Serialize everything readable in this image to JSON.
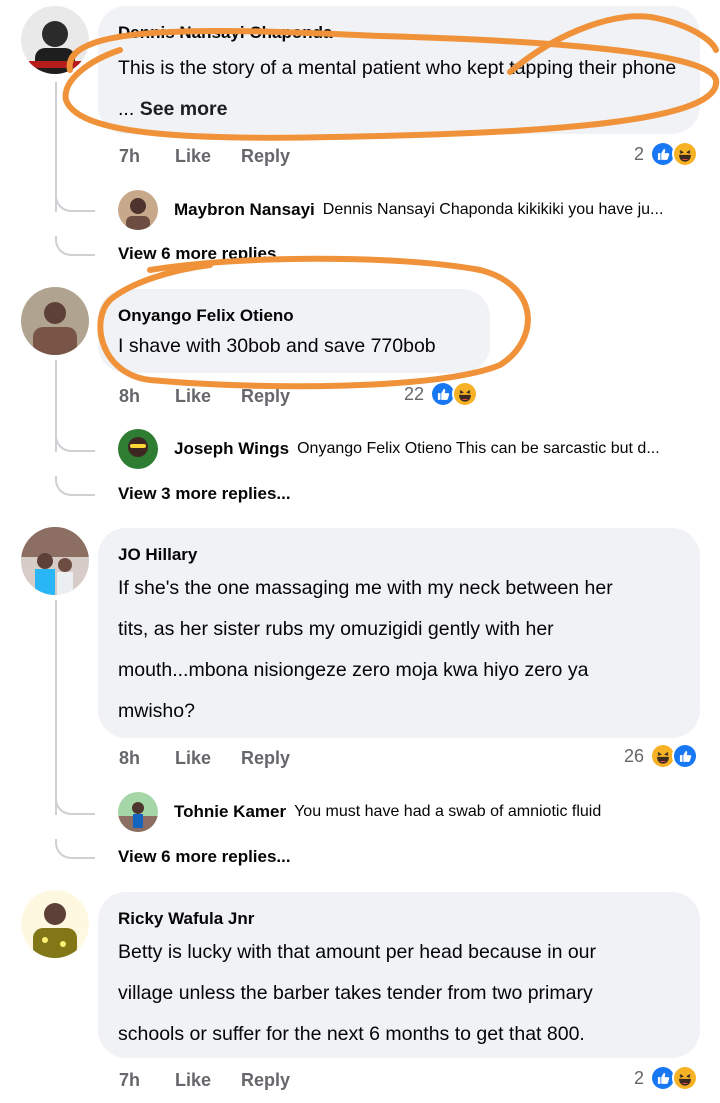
{
  "comments": [
    {
      "author": "Dennis Nansayi Chaponda",
      "text": "This is the story of a mental patient who kept tapping their phone ...",
      "see_more": "See more",
      "time": "7h",
      "like": "Like",
      "reply": "Reply",
      "reaction_count": "2",
      "reply_preview": {
        "name": "Maybron Nansayi",
        "text": "Dennis Nansayi Chaponda kikikiki you have ju..."
      },
      "view_more": "View 6 more replies..."
    },
    {
      "author": "Onyango Felix Otieno",
      "text": "I shave with 30bob and save 770bob",
      "time": "8h",
      "like": "Like",
      "reply": "Reply",
      "reaction_count": "22",
      "reply_preview": {
        "name": "Joseph Wings",
        "text": "Onyango Felix Otieno This can be sarcastic but d..."
      },
      "view_more": "View 3 more replies..."
    },
    {
      "author": "JO Hillary",
      "text_lines": [
        "If she's the one massaging me with my neck between her",
        "tits, as her sister rubs my omuzigidi gently with her",
        "mouth...mbona nisiongeze zero moja kwa hiyo zero ya",
        "mwisho?"
      ],
      "time": "8h",
      "like": "Like",
      "reply": "Reply",
      "reaction_count": "26",
      "reply_preview": {
        "name": "Tohnie Kamer",
        "text": "You must have had a swab of amniotic fluid"
      },
      "view_more": "View 6 more replies..."
    },
    {
      "author": "Ricky Wafula Jnr",
      "text_lines": [
        "Betty is lucky with that amount per head because in our",
        "village unless the barber takes tender from two primary",
        "schools  or  suffer for the next 6 months to get that 800."
      ],
      "time": "7h",
      "like": "Like",
      "reply": "Reply",
      "reaction_count": "2"
    }
  ],
  "colors": {
    "bubble": "#f0f2f5",
    "meta_text": "#65676b",
    "like_blue": "#1877f2",
    "haha_yellow": "#f7b125",
    "annotation_orange": "#f0923a",
    "thread_line": "#ced0d4"
  },
  "icons": [
    "like-reaction-icon",
    "haha-reaction-icon"
  ]
}
